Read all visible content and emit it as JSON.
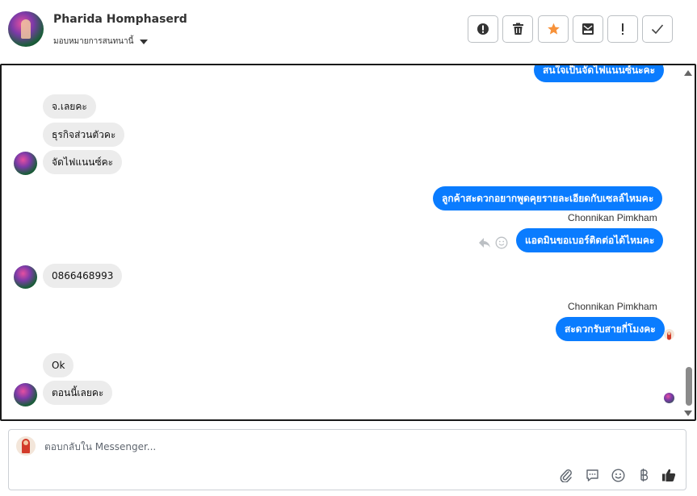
{
  "contact": {
    "name": "Pharida Homphaserd",
    "assign_label": "มอบหมายการสนทนานี้"
  },
  "toolbar": [
    {
      "name": "report-button",
      "icon": "exclamation-circle-icon"
    },
    {
      "name": "delete-button",
      "icon": "trash-icon"
    },
    {
      "name": "star-button",
      "icon": "star-icon",
      "color": "#f7923a"
    },
    {
      "name": "archive-button",
      "icon": "mail-archive-icon"
    },
    {
      "name": "flag-button",
      "icon": "exclamation-icon"
    },
    {
      "name": "mark-done-button",
      "icon": "checkmark-icon"
    }
  ],
  "messages": {
    "m0": "สนใจเป็นจัดไฟแนนซ์นะคะ",
    "m1": "จ.เลยคะ",
    "m2": "ธุรกิจส่วนตัวคะ",
    "m3": "จัดไฟแนนซ์คะ",
    "m4": "ลูกค้าสะดวกอยากพูดคุยรายละเอียดกับเซลล์ไหมคะ",
    "sender1": "Chonnikan Pimkham",
    "m5": "แอดมินขอเบอร์ติดต่อได้ไหมคะ",
    "m6": "0866468993",
    "sender2": "Chonnikan Pimkham",
    "m7": "สะดวกรับสายกี่โมงคะ",
    "m8": "Ok",
    "m9": "ตอนนี้เลยคะ"
  },
  "composer": {
    "placeholder": "ตอบกลับใน Messenger..."
  },
  "composer_icons": [
    "paperclip-icon",
    "saved-reply-icon",
    "emoji-icon",
    "baht-payment-icon",
    "thumbs-up-icon"
  ],
  "colors": {
    "outgoing_bubble": "#0a7cff",
    "incoming_bubble": "#ececec"
  }
}
